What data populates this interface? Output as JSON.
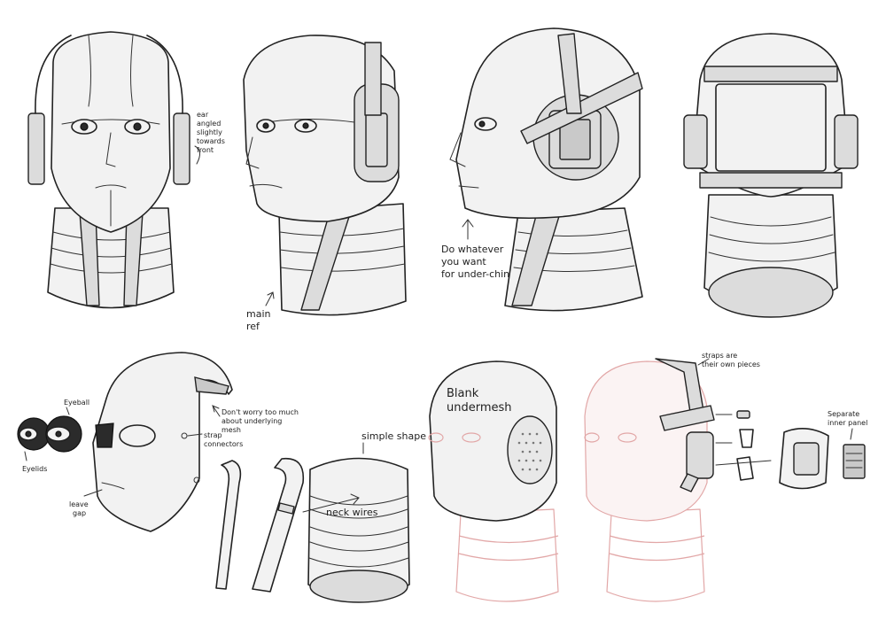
{
  "annotations": {
    "ear_note": [
      "ear",
      "angled",
      "slightly",
      "towards",
      "front"
    ],
    "main_ref": [
      "main",
      "ref"
    ],
    "under_chin": [
      "Do whatever",
      "you want",
      "for under-chin"
    ],
    "eyeball": "Eyeball",
    "eyelids": "Eyelids",
    "leave_gap": [
      "leave",
      "gap"
    ],
    "strap_connectors": [
      "strap",
      "connectors"
    ],
    "dont_worry": [
      "Don't worry too much",
      "about underlying",
      "mesh"
    ],
    "simple_shape": "simple shape",
    "neck_wires": "neck wires",
    "blank_undermesh": [
      "Blank",
      "undermesh"
    ],
    "straps_own_pieces": [
      "straps are",
      "their own pieces"
    ],
    "separate_panel": [
      "Separate",
      "inner panel"
    ]
  },
  "colors": {
    "ink": "#222222",
    "shade": "#dcdcdc",
    "ghost": "#e2a7a7"
  }
}
